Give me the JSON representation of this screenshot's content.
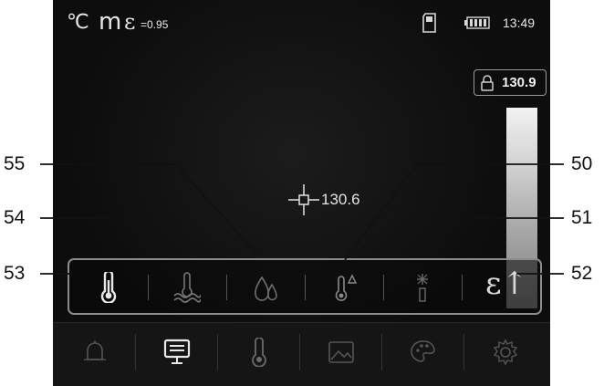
{
  "status": {
    "unit": "℃",
    "mode": "m",
    "emissivity_symbol": "ε",
    "emissivity_value": "=0.95",
    "time": "13:49",
    "icons": [
      "sd-card-icon",
      "battery-icon"
    ]
  },
  "lock": {
    "icon": "lock-icon",
    "value": "130.9"
  },
  "center": {
    "value": "130.6"
  },
  "submenu": {
    "items": [
      {
        "icon": "thermometer-icon"
      },
      {
        "icon": "ambient-temperature-icon"
      },
      {
        "icon": "humidity-drops-icon"
      },
      {
        "icon": "thermometer-delta-icon"
      },
      {
        "icon": "laser-pointer-icon"
      },
      {
        "icon": "emissivity-icon",
        "label": "ε↑"
      }
    ]
  },
  "mainmenu": {
    "items": [
      {
        "icon": "bell-icon"
      },
      {
        "icon": "display-icon"
      },
      {
        "icon": "thermometer-icon"
      },
      {
        "icon": "image-icon"
      },
      {
        "icon": "palette-icon"
      },
      {
        "icon": "gear-icon"
      }
    ]
  },
  "callouts": {
    "c55": "55",
    "c54": "54",
    "c53": "53",
    "c50": "50",
    "c51": "51",
    "c52": "52"
  },
  "colors": {
    "icon": "#d8d8d8",
    "frame": "#8c8c8c",
    "screen": "#0d0d0d"
  }
}
